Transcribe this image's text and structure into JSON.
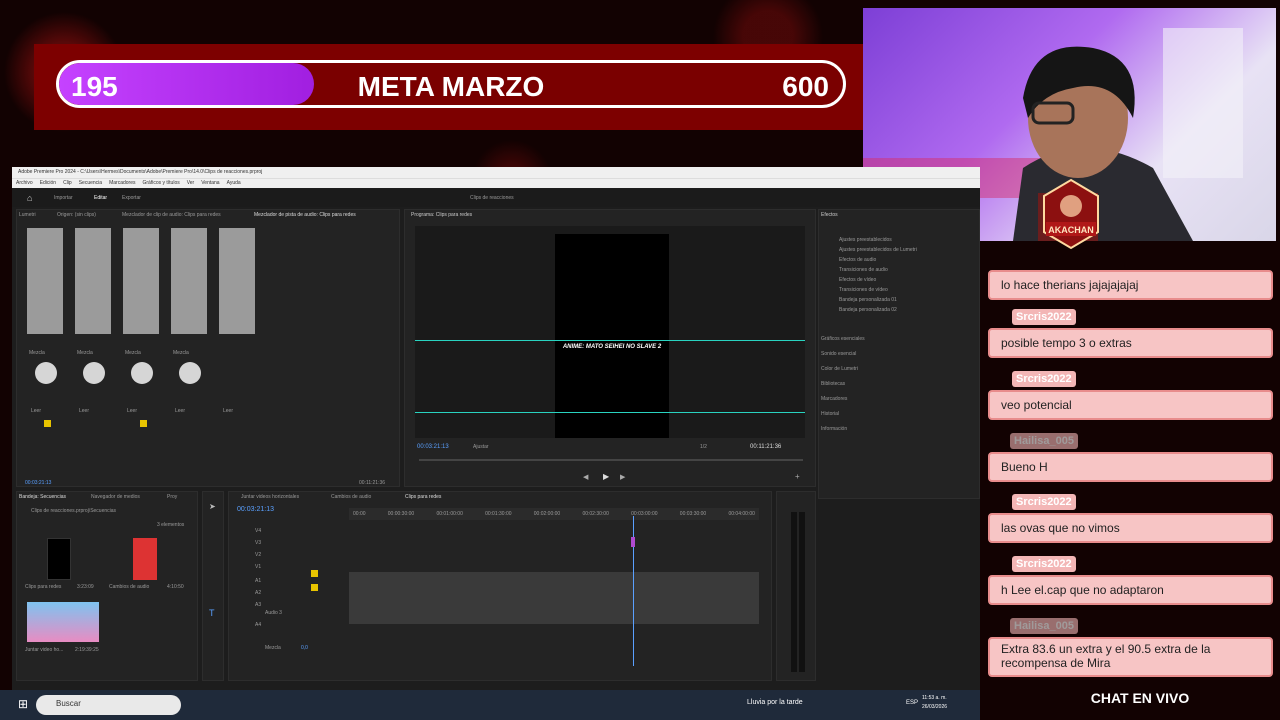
{
  "goal": {
    "current": "195",
    "title": "META MARZO",
    "target": "600",
    "progress_fraction": 0.325
  },
  "premiere": {
    "title_bar": "Adobe Premiere Pro 2024 - C:\\Users\\Hermes\\Documents\\Adobe\\Premiere Pro\\14.0\\Clips de reacciones.prproj",
    "menu": [
      "Archivo",
      "Edición",
      "Clip",
      "Secuencia",
      "Marcadores",
      "Gráficos y títulos",
      "Ver",
      "Ventana",
      "Ayuda"
    ],
    "workspace_tabs": [
      "Importar",
      "Editar",
      "Exportar"
    ],
    "project_name": "Clips de reacciones",
    "panel_tabs": [
      "Lumetri",
      "Origen: (sin clips)",
      "Mezclador de clip de audio: Clips para redes",
      "Mezclador de pista de audio: Clips para redes"
    ],
    "program_title": "Programa: Clips para redes",
    "effects_title": "Efectos",
    "effects_items": [
      "Ajustes preestablecidos",
      "Ajustes preestablecidos de Lumetri",
      "Efectos de audio",
      "Transiciones de audio",
      "Efectos de vídeo",
      "Transiciones de vídeo",
      "Bandeja personalizada 01",
      "Bandeja personalizada 02"
    ],
    "side_panels": [
      "Gráficos esenciales",
      "Sonido esencial",
      "Color de Lumetri",
      "Bibliotecas",
      "Marcadores",
      "Historial",
      "Información"
    ],
    "monitor_caption": "ANIME: MATO SEIHEI NO SLAVE 2",
    "timecode_left": "00:03:21:13",
    "fit_label": "Ajustar",
    "scale": "1/2",
    "timecode_right": "00:11:21:36",
    "mixer_mode": "Mezcla",
    "mixer_read": "Leer",
    "mixer_time_left": "00:03:21:13",
    "mixer_time_right": "00:11:21:36",
    "bin_tabs": [
      "Bandeja: Secuencias",
      "Navegador de medios",
      "Proy"
    ],
    "bin_path": "Clips de reacciones.prproj\\Secuencias",
    "bin_count": "3 elementos",
    "bin_items": [
      {
        "name": "Clips para redes",
        "dur": "3:23:09"
      },
      {
        "name": "Cambios de audio",
        "dur": "4:10:50"
      },
      {
        "name": "Juntar video ho...",
        "dur": "2:19:39:25"
      }
    ],
    "timeline_tabs": [
      "Juntar videos horizontales",
      "Cambios de audio",
      "Clips para redes"
    ],
    "timeline_timecode": "00:03:21:13",
    "ruler": [
      "00:00",
      "00:00:30:00",
      "00:01:00:00",
      "00:01:30:00",
      "00:02:00:00",
      "00:02:30:00",
      "00:03:00:00",
      "00:03:30:00",
      "00:04:00:00",
      "00:04:30:00"
    ],
    "tracks": [
      "V4",
      "V3",
      "V2",
      "V1",
      "A1",
      "A2",
      "A3",
      "A4"
    ],
    "audio3_label": "Audio 3",
    "mix_label": "Mezcla",
    "mix_value": "0,0"
  },
  "chat": {
    "messages": [
      {
        "user": "",
        "text": "lo hace therians jajajajajaj"
      },
      {
        "user": "Srcris2022",
        "text": "posible tempo 3 o extras"
      },
      {
        "user": "Srcris2022",
        "text": "veo potencial"
      },
      {
        "user": "Hailisa_005",
        "text": "Bueno H"
      },
      {
        "user": "Srcris2022",
        "text": "las ovas que no vimos"
      },
      {
        "user": "Srcris2022",
        "text": "h Lee el.cap que no adaptaron"
      },
      {
        "user": "Hailisa_005",
        "text": "Extra 83.6 un extra y el 90.5 extra de la recompensa de Mira"
      }
    ],
    "footer": "CHAT EN VIVO"
  },
  "taskbar": {
    "search_placeholder": "Buscar",
    "weather": "Lluvia por la tarde",
    "lang": "ESP",
    "time": "11:53 a. m.",
    "date": "26/03/2026"
  },
  "logo_text": "AKACHAN"
}
